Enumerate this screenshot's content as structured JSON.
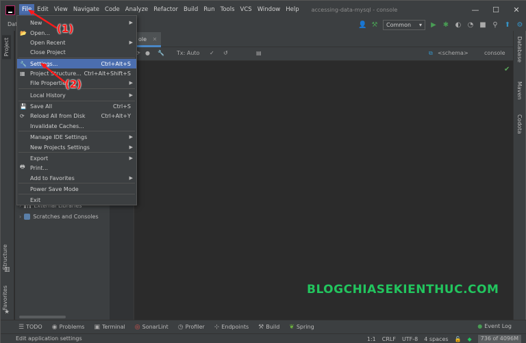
{
  "window": {
    "title": "accessing-data-mysql - console",
    "controls": [
      "—",
      "☐",
      "✕"
    ]
  },
  "menubar": {
    "items": [
      "File",
      "Edit",
      "View",
      "Navigate",
      "Code",
      "Analyze",
      "Refactor",
      "Build",
      "Run",
      "Tools",
      "VCS",
      "Window",
      "Help"
    ]
  },
  "toolbar": {
    "left_label": "Dat",
    "run_config": "Common"
  },
  "editor": {
    "tab_label": "ole",
    "tx_mode": "Tx: Auto",
    "schema": "<schema>",
    "console": "console"
  },
  "project_tree": [
    {
      "label": "External Libraries"
    },
    {
      "label": "Scratches and Consoles"
    }
  ],
  "left_stripe": {
    "project": "Project",
    "structure": "Structure",
    "favorites": "Favorites"
  },
  "right_stripe": {
    "database": "Database",
    "maven": "Maven",
    "codota": "Codota"
  },
  "file_menu": [
    {
      "label": "New",
      "shortcut": "",
      "submenu": true,
      "icon": ""
    },
    {
      "label": "Open...",
      "shortcut": "",
      "submenu": false,
      "icon": "folder-icon"
    },
    {
      "label": "Open Recent",
      "shortcut": "",
      "submenu": true,
      "icon": ""
    },
    {
      "label": "Close Project",
      "shortcut": "",
      "submenu": false,
      "icon": ""
    },
    {
      "label": "Settings...",
      "shortcut": "Ctrl+Alt+S",
      "submenu": false,
      "icon": "wrench-icon",
      "highlighted": true
    },
    {
      "label": "Project Structure...",
      "shortcut": "Ctrl+Alt+Shift+S",
      "submenu": false,
      "icon": "structure-icon"
    },
    {
      "label": "File Properties",
      "shortcut": "",
      "submenu": true,
      "icon": ""
    },
    {
      "label": "Local History",
      "shortcut": "",
      "submenu": true,
      "icon": ""
    },
    {
      "label": "Save All",
      "shortcut": "Ctrl+S",
      "submenu": false,
      "icon": "save-icon"
    },
    {
      "label": "Reload All from Disk",
      "shortcut": "Ctrl+Alt+Y",
      "submenu": false,
      "icon": "reload-icon"
    },
    {
      "label": "Invalidate Caches...",
      "shortcut": "",
      "submenu": false,
      "icon": ""
    },
    {
      "label": "Manage IDE Settings",
      "shortcut": "",
      "submenu": true,
      "icon": ""
    },
    {
      "label": "New Projects Settings",
      "shortcut": "",
      "submenu": true,
      "icon": ""
    },
    {
      "label": "Export",
      "shortcut": "",
      "submenu": true,
      "icon": ""
    },
    {
      "label": "Print...",
      "shortcut": "",
      "submenu": false,
      "icon": "print-icon"
    },
    {
      "label": "Add to Favorites",
      "shortcut": "",
      "submenu": true,
      "icon": ""
    },
    {
      "label": "Power Save Mode",
      "shortcut": "",
      "submenu": false,
      "icon": ""
    },
    {
      "label": "Exit",
      "shortcut": "",
      "submenu": false,
      "icon": ""
    }
  ],
  "annotations": {
    "step1": "(1)",
    "step2": "(2)"
  },
  "watermark": "BLOGCHIASEKIENTHUC.COM",
  "bottom_bar": {
    "items": [
      "TODO",
      "Problems",
      "Terminal",
      "SonarLint",
      "Profiler",
      "Endpoints",
      "Build",
      "Spring"
    ],
    "event_log": "Event Log"
  },
  "status_bar": {
    "message": "Edit application settings",
    "position": "1:1",
    "line_sep": "CRLF",
    "encoding": "UTF-8",
    "indent": "4 spaces",
    "memory": "736 of 4096M"
  },
  "colors": {
    "accent": "#4b6eaf",
    "annotation": "#ff1a1a",
    "watermark": "#22c55e"
  }
}
